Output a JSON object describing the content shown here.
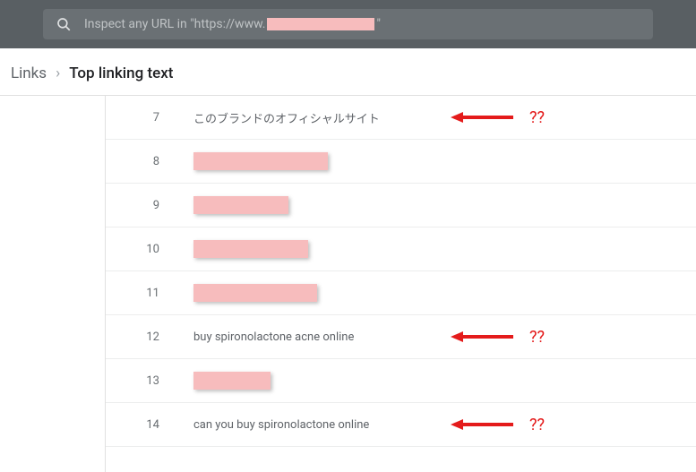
{
  "search": {
    "placeholder_prefix": "Inspect any URL in \"https://www.",
    "placeholder_suffix": "\""
  },
  "breadcrumb": {
    "parent": "Links",
    "current": "Top linking text"
  },
  "rows": [
    {
      "num": "7",
      "text": "このブランドのオフィシャルサイト",
      "redacted": false,
      "arrow": true
    },
    {
      "num": "8",
      "text": "",
      "redacted": true,
      "w": "w1",
      "arrow": false
    },
    {
      "num": "9",
      "text": "",
      "redacted": true,
      "w": "w2",
      "arrow": false
    },
    {
      "num": "10",
      "text": "",
      "redacted": true,
      "w": "w3",
      "arrow": false
    },
    {
      "num": "11",
      "text": "",
      "redacted": true,
      "w": "w4",
      "arrow": false
    },
    {
      "num": "12",
      "text": "buy spironolactone acne online",
      "redacted": false,
      "arrow": true
    },
    {
      "num": "13",
      "text": "",
      "redacted": true,
      "w": "w5",
      "arrow": false
    },
    {
      "num": "14",
      "text": "can you buy spironolactone online",
      "redacted": false,
      "arrow": true
    }
  ],
  "annotation": {
    "qmarks": "??"
  }
}
